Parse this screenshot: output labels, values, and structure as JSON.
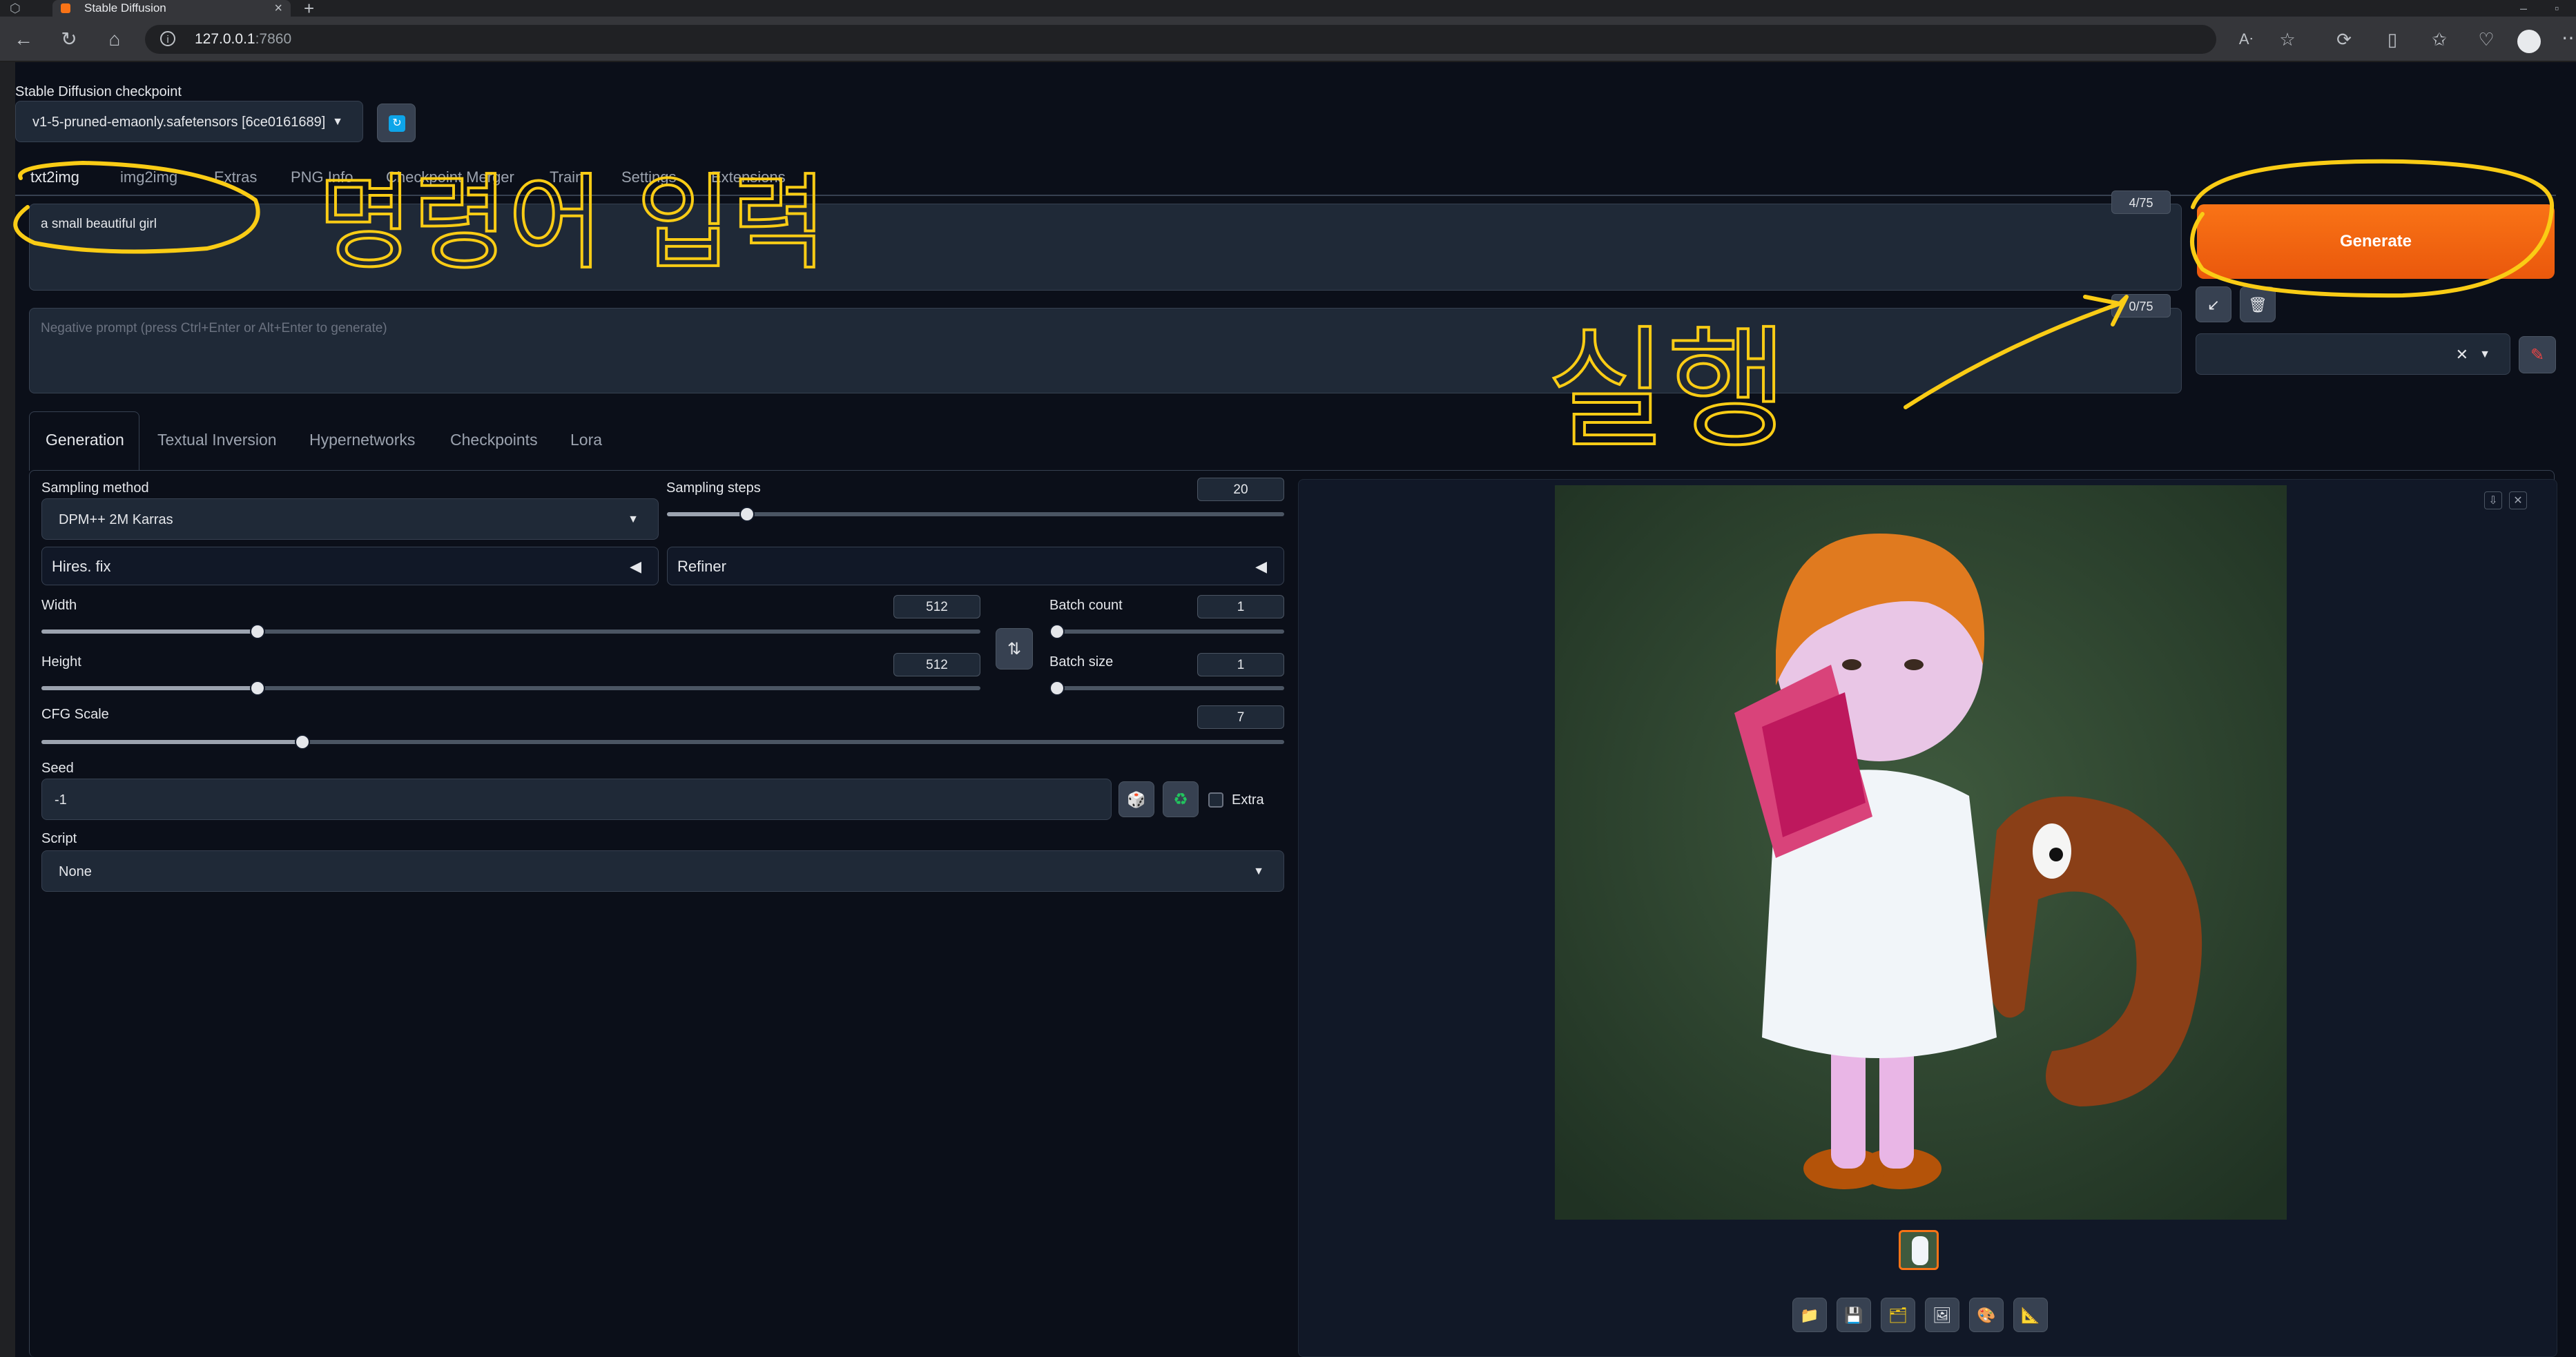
{
  "browser": {
    "tab_title": "Stable Diffusion",
    "url_host": "127.0.0.1",
    "url_port": ":7860"
  },
  "checkpoint": {
    "label": "Stable Diffusion checkpoint",
    "value": "v1-5-pruned-emaonly.safetensors [6ce0161689]"
  },
  "main_tabs": [
    "txt2img",
    "img2img",
    "Extras",
    "PNG Info",
    "Checkpoint Merger",
    "Train",
    "Settings",
    "Extensions"
  ],
  "prompt": {
    "value": "a small beautiful girl",
    "counter": "4/75"
  },
  "negative_prompt": {
    "placeholder": "Negative prompt (press Ctrl+Enter or Alt+Enter to generate)",
    "counter": "0/75"
  },
  "generate_label": "Generate",
  "sub_tabs": [
    "Generation",
    "Textual Inversion",
    "Hypernetworks",
    "Checkpoints",
    "Lora"
  ],
  "sampling_method": {
    "label": "Sampling method",
    "value": "DPM++ 2M Karras"
  },
  "sampling_steps": {
    "label": "Sampling steps",
    "value": "20",
    "fraction": 0.13
  },
  "hires_fix": "Hires. fix",
  "refiner": "Refiner",
  "width": {
    "label": "Width",
    "value": "512",
    "fraction": 0.23
  },
  "height": {
    "label": "Height",
    "value": "512",
    "fraction": 0.23
  },
  "batch_count": {
    "label": "Batch count",
    "value": "1",
    "fraction": 0.0
  },
  "batch_size": {
    "label": "Batch size",
    "value": "1",
    "fraction": 0.0
  },
  "cfg_scale": {
    "label": "CFG Scale",
    "value": "7",
    "fraction": 0.21
  },
  "seed": {
    "label": "Seed",
    "value": "-1",
    "extra_label": "Extra"
  },
  "script": {
    "label": "Script",
    "value": "None"
  },
  "annotations": [
    "명령어 입력",
    "실행"
  ],
  "colors": {
    "accent": "#ea580c",
    "background": "#0b0f19",
    "annotation": "#facc15"
  }
}
